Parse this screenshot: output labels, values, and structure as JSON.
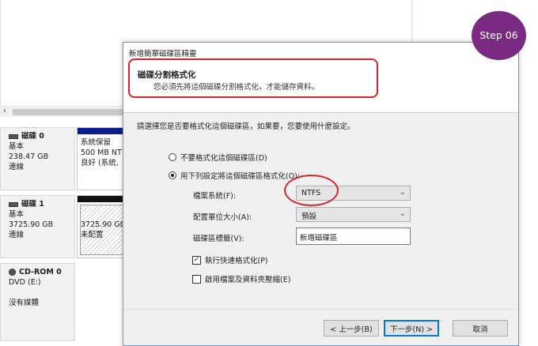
{
  "step_badge": "Step 06",
  "background": {
    "disks": [
      {
        "title": "磁碟 0",
        "type": "基本",
        "size": "238.47 GB",
        "status": "連線"
      },
      {
        "title": "磁碟 1",
        "type": "基本",
        "size": "3725.90 GB",
        "status": "連線"
      },
      {
        "title": "CD-ROM 0",
        "type": "DVD (E:)",
        "size": "",
        "status": "沒有媒體"
      }
    ],
    "partitions": [
      {
        "line1": "系統保留",
        "line2": "500 MB NT",
        "line3": "良好 (系統,"
      },
      {
        "line1": "",
        "line2": "3725.90 GB",
        "line3": "未配置"
      }
    ]
  },
  "dialog": {
    "title": "新增簡單磁碟區精靈",
    "header_title": "磁碟分割格式化",
    "header_subtitle": "您必須先將這個磁碟分割格式化，才能儲存資料。",
    "prompt": "請選擇您是否要格式化這個磁碟區，如果要，您要使用什麼設定。",
    "radio_no_format": "不要格式化這個磁碟區(D)",
    "radio_format": "用下列設定將這個磁碟區格式化(O):",
    "fs_label": "檔案系統(F):",
    "fs_value": "NTFS",
    "alloc_label": "配置單位大小(A):",
    "alloc_value": "預設",
    "vol_label": "磁碟區標籤(V):",
    "vol_value": "新增磁碟區",
    "quick_format": "執行快速格式化(P)",
    "compression": "啟用檔案及資料夾壓縮(E)",
    "back_button": "< 上一步(B)",
    "next_button": "下一步(N) >",
    "cancel_button": "取消"
  }
}
